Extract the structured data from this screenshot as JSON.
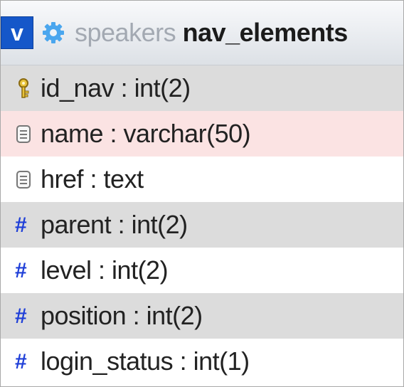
{
  "header": {
    "toggle_label": "v",
    "database": "speakers",
    "table": "nav_elements"
  },
  "columns": [
    {
      "text": "id_nav : int(2)",
      "icon": "primary-key-icon",
      "bg": "#dcdcdc"
    },
    {
      "text": "name : varchar(50)",
      "icon": "text-column-icon",
      "bg": "#fbe3e3"
    },
    {
      "text": "href : text",
      "icon": "text-column-icon",
      "bg": "#ffffff"
    },
    {
      "text": "parent : int(2)",
      "icon": "numeric-column-icon",
      "bg": "#dcdcdc"
    },
    {
      "text": "level : int(2)",
      "icon": "numeric-column-icon",
      "bg": "#ffffff"
    },
    {
      "text": "position : int(2)",
      "icon": "numeric-column-icon",
      "bg": "#dcdcdc"
    },
    {
      "text": "login_status : int(1)",
      "icon": "numeric-column-icon",
      "bg": "#ffffff"
    }
  ],
  "numeric_symbol": "#",
  "colors": {
    "toggle": "#1557c9",
    "numeric_icon": "#1f3fd8",
    "row_alt": "#dcdcdc",
    "row_highlight": "#fbe3e3"
  }
}
